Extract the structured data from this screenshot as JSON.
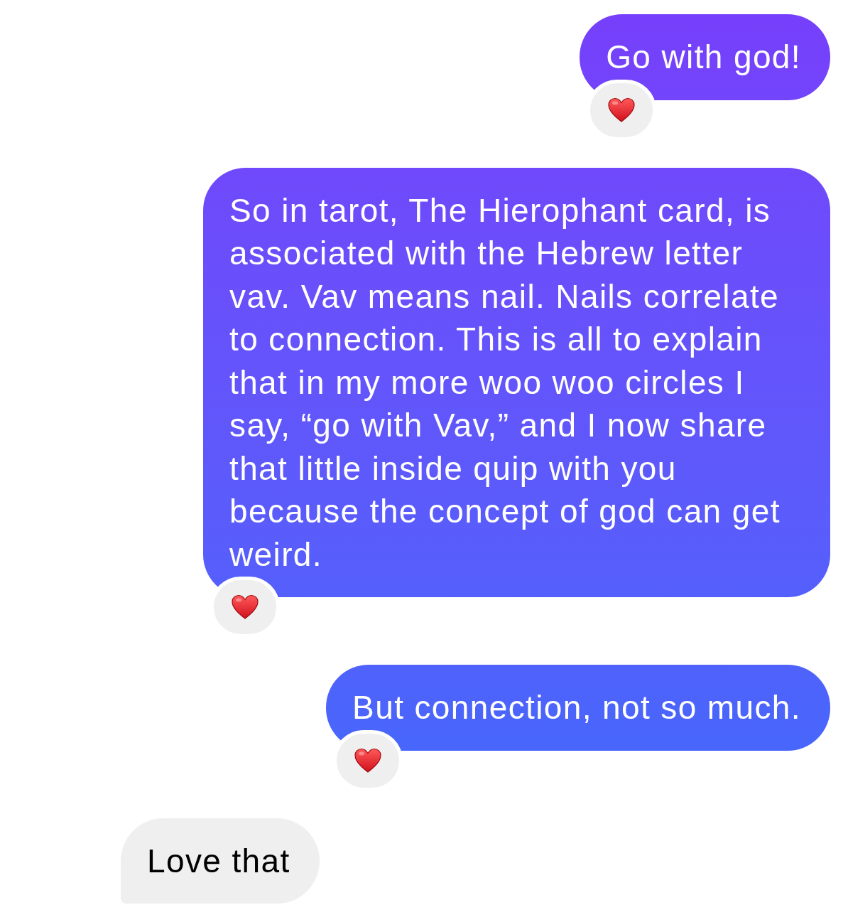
{
  "messages": [
    {
      "kind": "sent",
      "text": "Go with god!",
      "reacted": true
    },
    {
      "kind": "sent",
      "text": "So in tarot, The Hierophant card, is associated with the Hebrew letter vav. Vav means nail. Nails correlate to connection. This is all to explain that in my more woo woo circles I say, “go with Vav,” and I now share that little inside quip with you because the concept of god can get weird.",
      "reacted": true
    },
    {
      "kind": "sent",
      "text": "But connection, not so much.",
      "reacted": true
    },
    {
      "kind": "received",
      "text": "Love that",
      "reacted": false
    }
  ]
}
